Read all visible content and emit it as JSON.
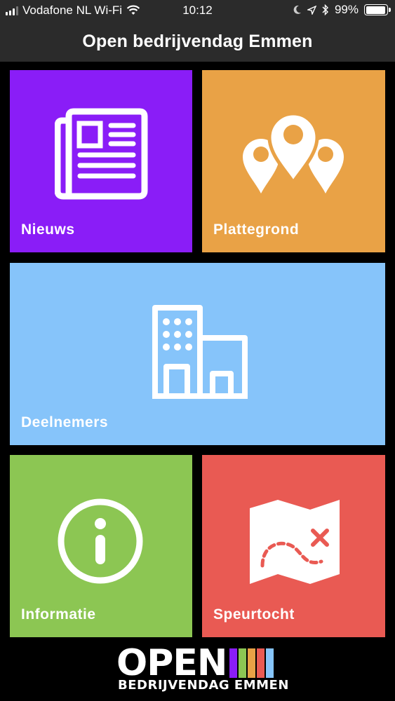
{
  "status_bar": {
    "carrier": "Vodafone NL Wi-Fi",
    "time": "10:12",
    "battery": "99%",
    "icons": [
      "signal-icon",
      "wifi-icon",
      "moon-icon",
      "location-icon",
      "bluetooth-icon",
      "battery-icon"
    ]
  },
  "header": {
    "title": "Open bedrijvendag Emmen"
  },
  "tiles": [
    {
      "label": "Nieuws",
      "icon": "newspaper-icon",
      "color": "#8a1df7"
    },
    {
      "label": "Plattegrond",
      "icon": "map-pins-icon",
      "color": "#e9a246"
    },
    {
      "label": "Deelnemers",
      "icon": "building-icon",
      "color": "#86c4fa"
    },
    {
      "label": "Informatie",
      "icon": "info-icon",
      "color": "#8cc653"
    },
    {
      "label": "Speurtocht",
      "icon": "treasure-map-icon",
      "color": "#e95a53"
    }
  ],
  "footer_logo": {
    "word": "OPEN",
    "subtitle": "BEDRIJVENDAG EMMEN",
    "stripe_colors": [
      "#8a1df7",
      "#8cc653",
      "#e9a246",
      "#e95a53",
      "#86c4fa"
    ]
  }
}
